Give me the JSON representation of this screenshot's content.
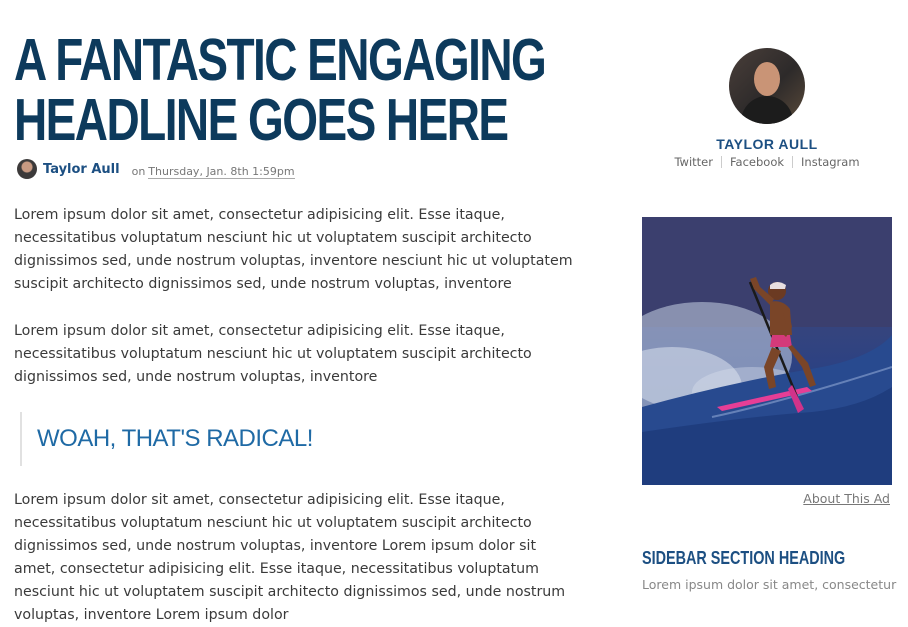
{
  "article": {
    "headline_line1": "A FANTASTIC ENGAGING",
    "headline_line2": "HEADLINE GOES HERE",
    "author": "Taylor Aull",
    "date_prefix": "on",
    "date": "Thursday, Jan. 8th 1:59pm",
    "paragraphs": [
      "Lorem ipsum dolor sit amet, consectetur adipisicing elit. Esse itaque, necessitatibus voluptatum nesciunt hic ut voluptatem suscipit architecto dignissimos sed, unde nostrum voluptas, inventore nesciunt hic ut voluptatem suscipit architecto dignissimos sed, unde nostrum voluptas, inventore",
      "Lorem ipsum dolor sit amet, consectetur adipisicing elit. Esse itaque, necessitatibus voluptatum nesciunt hic ut voluptatem suscipit architecto dignissimos sed, unde nostrum voluptas, inventore",
      "Lorem ipsum dolor sit amet, consectetur adipisicing elit. Esse itaque, necessitatibus voluptatum nesciunt hic ut voluptatem suscipit architecto dignissimos sed, unde nostrum voluptas, inventore Lorem ipsum dolor sit amet, consectetur adipisicing elit. Esse itaque, necessitatibus voluptatum nesciunt hic ut voluptatem suscipit architecto dignissimos sed, unde nostrum voluptas, inventore Lorem ipsum dolor"
    ],
    "pullquote": "WOAH, THAT'S RADICAL!"
  },
  "sidebar": {
    "author_name": "TAYLOR AULL",
    "social": [
      "Twitter",
      "Facebook",
      "Instagram"
    ],
    "about_ad": "About This Ad",
    "section_heading": "SIDEBAR SECTION HEADING",
    "section_text": "Lorem ipsum dolor sit amet, consectetur"
  },
  "colors": {
    "headline": "#0d3a5c",
    "accent": "#1c4f82",
    "pullquote": "#1f6aa5",
    "body_text": "#3a3a3a"
  }
}
